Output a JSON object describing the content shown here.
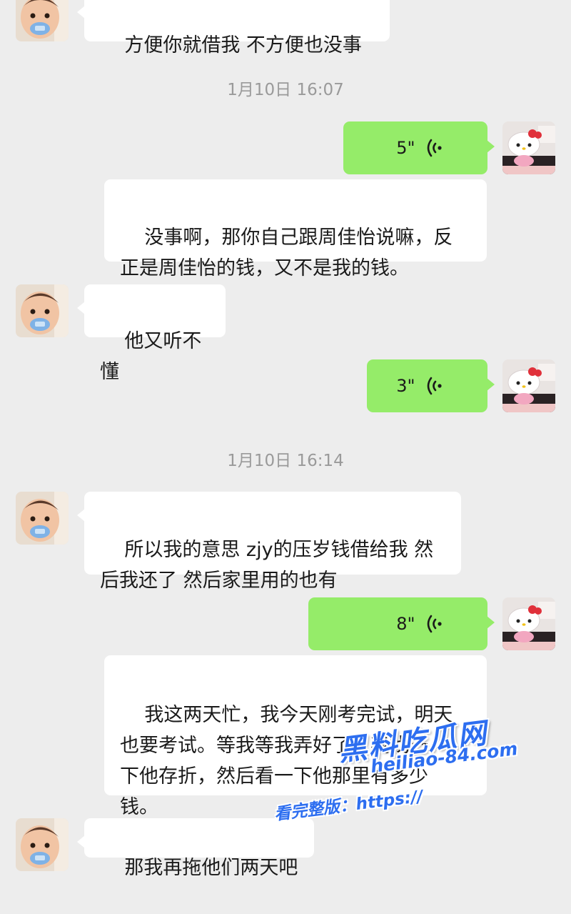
{
  "chat": {
    "messages": [
      {
        "kind": "text",
        "side": "left",
        "text": "方便你就借我 不方便也没事"
      },
      {
        "kind": "time",
        "text": "1月10日 16:07"
      },
      {
        "kind": "voice",
        "side": "right",
        "duration": "5\""
      },
      {
        "kind": "text",
        "side": "right-transcript",
        "text": "没事啊，那你自己跟周佳怡说嘛，反\n正是周佳怡的钱，又不是我的钱。"
      },
      {
        "kind": "text",
        "side": "left",
        "text": "他又听不懂"
      },
      {
        "kind": "voice",
        "side": "right",
        "duration": "3\""
      },
      {
        "kind": "time",
        "text": "1月10日 16:14"
      },
      {
        "kind": "text",
        "side": "left",
        "text": "所以我的意思 zjy的压岁钱借给我 然\n后我还了 然后家里用的也有"
      },
      {
        "kind": "voice",
        "side": "right",
        "duration": "8\""
      },
      {
        "kind": "text",
        "side": "right-transcript",
        "text": "我这两天忙，我今天刚考完试，明天\n也要考试。等我等我弄好了，我找一\n下他存折，然后看一下他那里有多少\n钱。"
      },
      {
        "kind": "text",
        "side": "left",
        "text": "那我再拖他们两天吧"
      }
    ]
  },
  "watermark": {
    "title": "黑料吃瓜网",
    "domain": "heiliao-84.com",
    "prefix": "看完整版：https://"
  },
  "colors": {
    "background": "#ededed",
    "bubble_white": "#ffffff",
    "bubble_green": "#95ec69",
    "timestamp": "#9a9a9a",
    "watermark_blue": "#2d6ef0"
  },
  "icons": {
    "voice": "voice-wave-icon",
    "contact_avatar": "baby-avatar-icon",
    "self_avatar": "hello-kitty-avatar-icon"
  }
}
